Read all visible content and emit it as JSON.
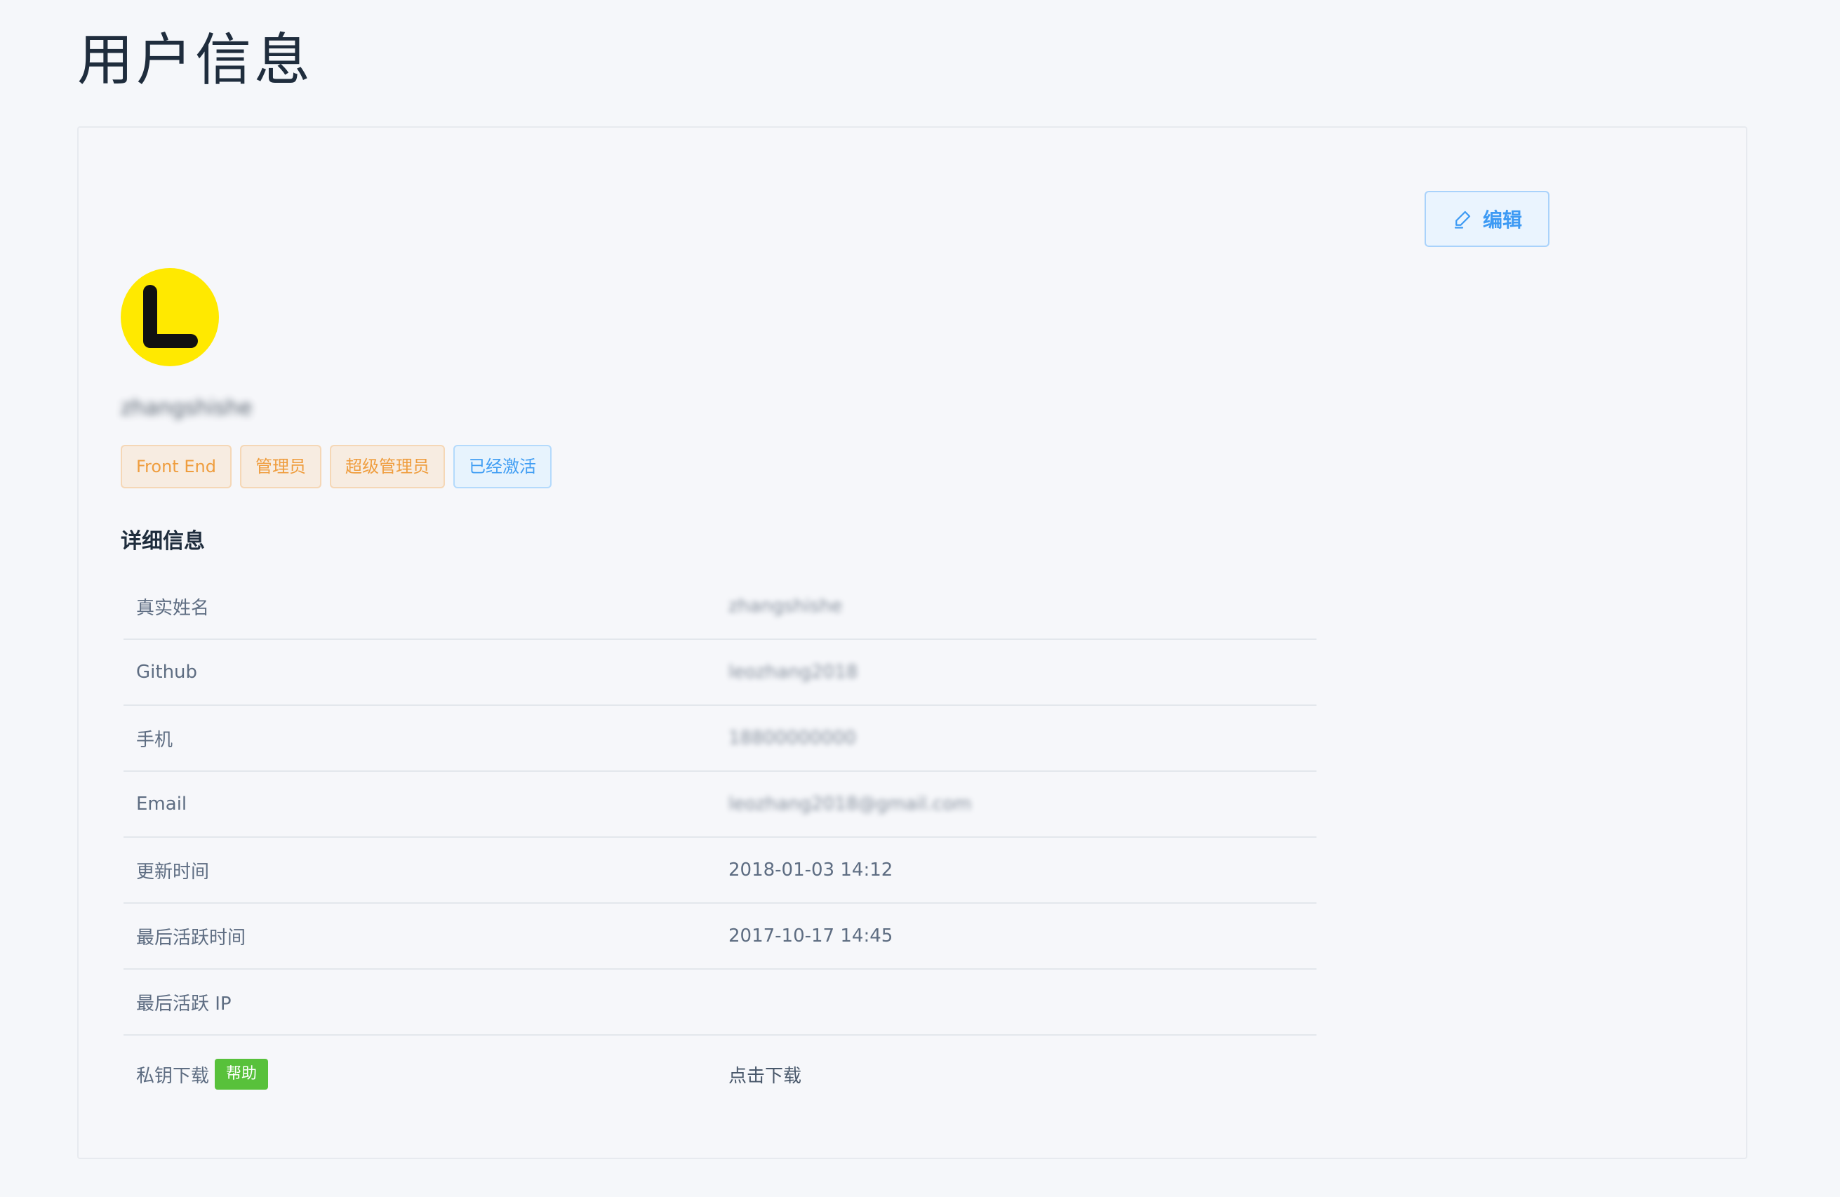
{
  "page": {
    "title": "用户信息"
  },
  "card": {
    "edit_label": "编辑",
    "avatar_letter": "L",
    "username": "zhangshishe",
    "tags": [
      {
        "label": "Front End",
        "kind": "warning"
      },
      {
        "label": "管理员",
        "kind": "warning"
      },
      {
        "label": "超级管理员",
        "kind": "warning"
      },
      {
        "label": "已经激活",
        "kind": "primary"
      }
    ],
    "section_title": "详细信息",
    "details": [
      {
        "key": "真实姓名",
        "value": "zhangshishe"
      },
      {
        "key": "Github",
        "value": "leozhang2018"
      },
      {
        "key": "手机",
        "value": "18800000000"
      },
      {
        "key": "Email",
        "value": "leozhang2018@gmail.com"
      },
      {
        "key": "更新时间",
        "value": "2018-01-03 14:12"
      },
      {
        "key": "最后活跃时间",
        "value": "2017-10-17 14:45"
      },
      {
        "key": "最后活跃 IP",
        "value": ""
      },
      {
        "key": "私钥下载",
        "value": "点击下载",
        "badge": "帮助"
      }
    ]
  },
  "colors": {
    "avatar_bg": "#ffe900",
    "warning_tag": "#ef9d3e",
    "primary_tag": "#3f9df3",
    "help_badge": "#58c13b"
  }
}
